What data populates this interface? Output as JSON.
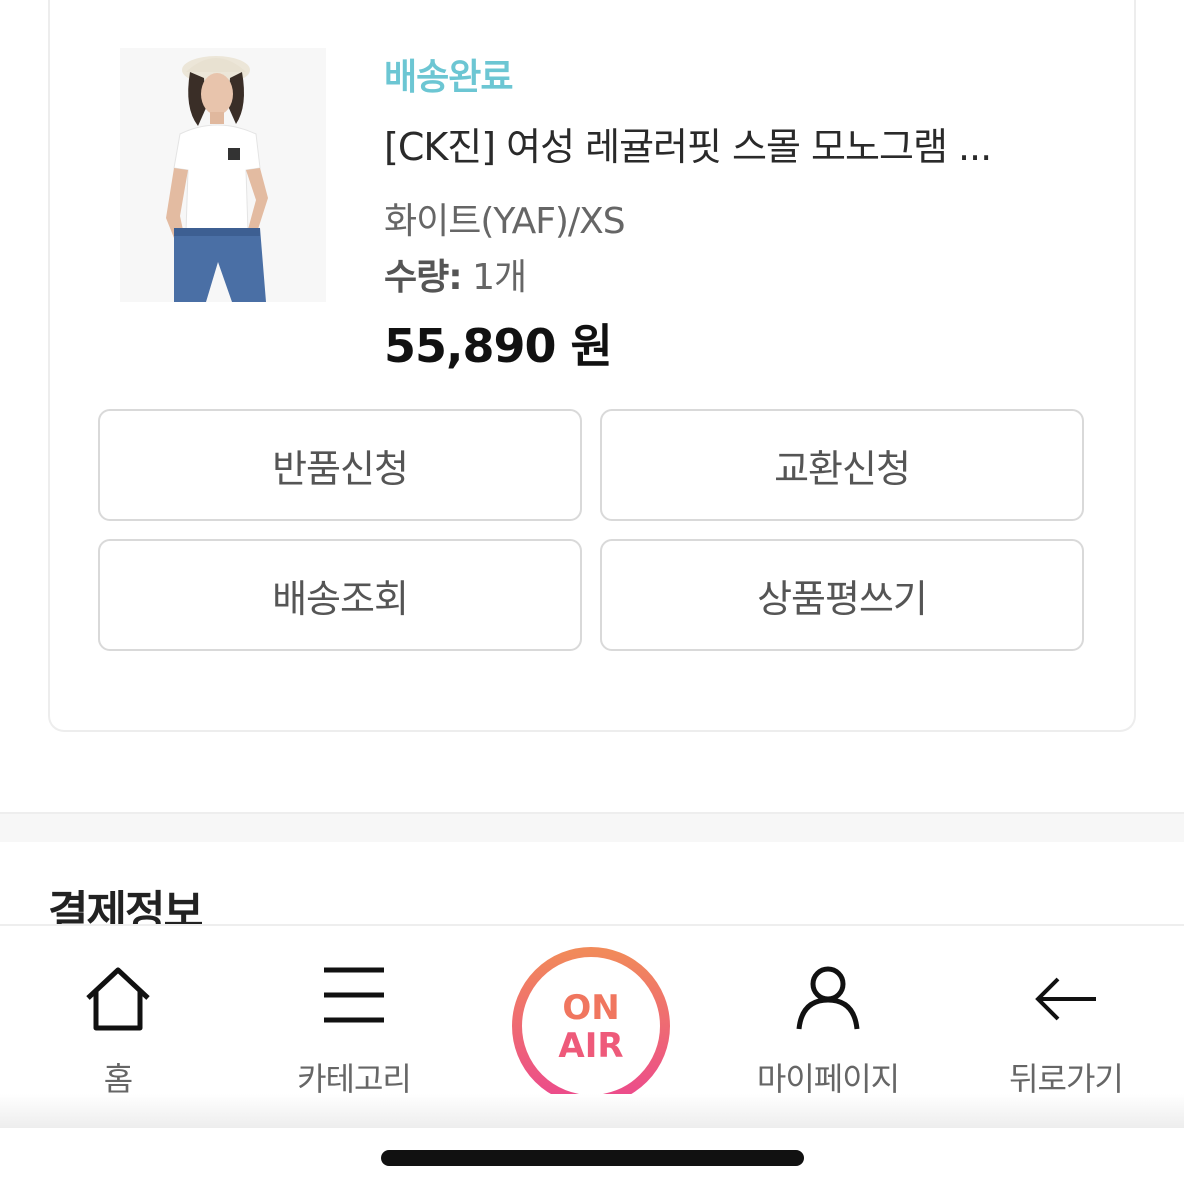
{
  "order": {
    "status": "배송완료",
    "product_name": "[CK진] 여성 레귤러핏 스몰 모노그램 ...",
    "option": "화이트(YAF)/XS",
    "qty_label": "수량:",
    "qty_value": "1개",
    "price": "55,890 원",
    "image_logo": "CK"
  },
  "actions": {
    "return_label": "반품신청",
    "exchange_label": "교환신청",
    "tracking_label": "배송조회",
    "review_label": "상품평쓰기"
  },
  "payment": {
    "title": "결제정보"
  },
  "nav": {
    "home": "홈",
    "category": "카테고리",
    "onair_line1": "ON",
    "onair_line2": "AIR",
    "mypage": "마이페이지",
    "back": "뒤로가기"
  },
  "colors": {
    "status": "#6cc6d3",
    "onair_gradient_start": "#f18a5a",
    "onair_gradient_end": "#ec4a8c"
  },
  "icons": [
    "house-icon",
    "menu-icon",
    "onair-icon",
    "person-icon",
    "arrow-left-icon"
  ]
}
